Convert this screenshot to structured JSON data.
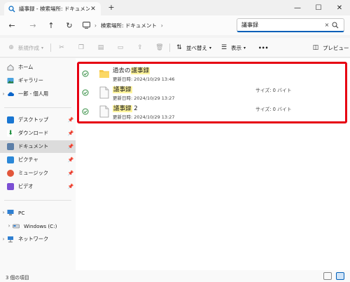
{
  "window": {
    "tab_title": "議事録 - 検索場所: ドキュメント",
    "tab_close": "✕",
    "new_tab": "+",
    "minimize": "—",
    "maximize": "☐",
    "close": "✕"
  },
  "address": {
    "breadcrumb": [
      "検索場所: ドキュメント"
    ],
    "search_value": "議事録",
    "search_clear": "×"
  },
  "toolbar": {
    "new_label": "新規作成",
    "sort_label": "並べ替え",
    "view_label": "表示",
    "more_label": "•••",
    "preview_label": "プレビュー"
  },
  "sidebar": {
    "quick": [
      {
        "label": "ホーム",
        "icon": "home-icon"
      },
      {
        "label": "ギャラリー",
        "icon": "gallery-icon"
      },
      {
        "label": "一郎 - 個人用",
        "icon": "cloud-icon"
      }
    ],
    "pinned": [
      {
        "label": "デスクトップ",
        "icon": "desktop-icon"
      },
      {
        "label": "ダウンロード",
        "icon": "download-icon"
      },
      {
        "label": "ドキュメント",
        "icon": "documents-icon"
      },
      {
        "label": "ピクチャ",
        "icon": "pictures-icon"
      },
      {
        "label": "ミュージック",
        "icon": "music-icon"
      },
      {
        "label": "ビデオ",
        "icon": "videos-icon"
      }
    ],
    "pc": [
      {
        "label": "PC",
        "icon": "pc-icon"
      },
      {
        "label": "Windows (C:)",
        "icon": "drive-icon"
      },
      {
        "label": "ネットワーク",
        "icon": "network-icon"
      }
    ]
  },
  "results": [
    {
      "prefix": "過去の",
      "match": "議事録",
      "suffix": "",
      "date": "更新日時: 2024/10/29 13:46",
      "size": "",
      "type": "folder"
    },
    {
      "prefix": "",
      "match": "議事録",
      "suffix": "",
      "date": "更新日時: 2024/10/29 13:27",
      "size": "サイズ: 0 バイト",
      "type": "file"
    },
    {
      "prefix": "",
      "match": "議事録",
      "suffix": " 2",
      "date": "更新日時: 2024/10/29 13:27",
      "size": "サイズ: 0 バイト",
      "type": "file"
    }
  ],
  "status": {
    "count": "3 個の項目"
  },
  "colors": {
    "accent": "#005fb8",
    "highlight_box": "#e60012",
    "match_highlight": "#fff59d",
    "synced_check": "#2e8b3e",
    "folder": "#f4c542"
  }
}
